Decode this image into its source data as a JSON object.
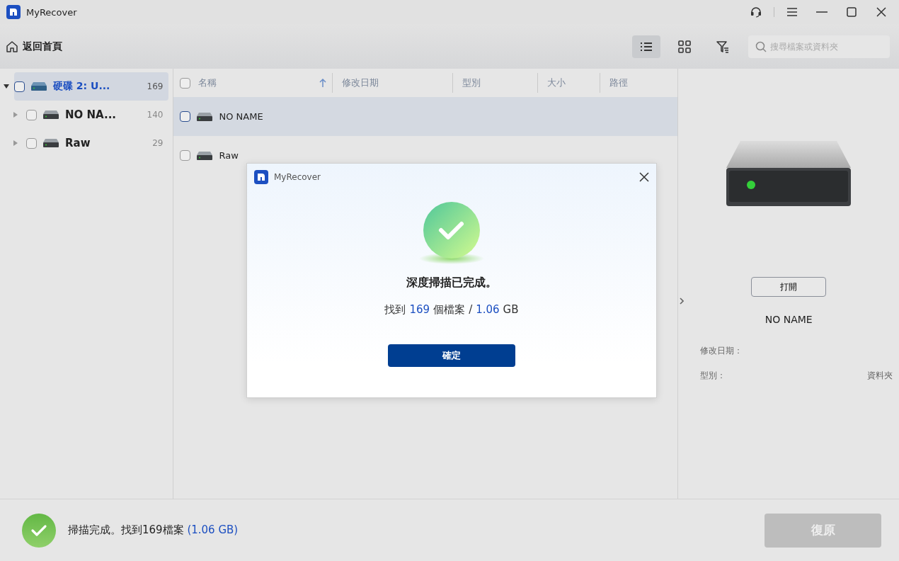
{
  "window": {
    "title": "MyRecover"
  },
  "title_bar_buttons": [
    {
      "kind": "support"
    },
    {
      "kind": "menu"
    },
    {
      "kind": "minimize"
    },
    {
      "kind": "maximize"
    },
    {
      "kind": "close"
    }
  ],
  "toolbar": {
    "back_label": "返回首頁",
    "views": [
      {
        "kind": "list",
        "selected": true
      },
      {
        "kind": "grid",
        "selected": false
      },
      {
        "kind": "filter",
        "selected": false
      }
    ],
    "search": {
      "placeholder": "搜尋檔案或資料夾"
    }
  },
  "tree": [
    {
      "label": "硬碟 2: U...",
      "count": "169",
      "selected": true,
      "expanded": true,
      "checked": false,
      "children": [
        {
          "label": "NO NA...",
          "count": "140",
          "selected": false,
          "expanded": false,
          "checked": false
        },
        {
          "label": "Raw",
          "count": "29",
          "selected": false,
          "expanded": false,
          "checked": false
        }
      ]
    }
  ],
  "table": {
    "all_checked": false,
    "columns": [
      {
        "label": "名稱",
        "sorted": true
      },
      {
        "label": "修改日期",
        "sorted": false
      },
      {
        "label": "型別",
        "sorted": false
      },
      {
        "label": "大小",
        "sorted": false
      },
      {
        "label": "路徑",
        "sorted": false
      }
    ],
    "rows": [
      {
        "name": "NO NAME",
        "selected": true,
        "checked": false
      },
      {
        "name": "Raw",
        "selected": false,
        "checked": false
      }
    ]
  },
  "details": {
    "open_button": "打開",
    "name": "NO NAME",
    "fields": [
      {
        "label": "修改日期："
      },
      {
        "label": "型別：",
        "value": "資料夾"
      }
    ]
  },
  "status_bar": {
    "message": "掃描完成。找到169檔案",
    "size": "(1.06 GB)",
    "recover_button": "復原",
    "recover_disabled": true
  },
  "dialog": {
    "title": "MyRecover",
    "heading": "深度掃描已完成。",
    "summary": [
      {
        "text": "找到",
        "highlight": false
      },
      {
        "text": "169",
        "highlight": true
      },
      {
        "text": "個檔案",
        "highlight": false
      },
      {
        "text": "/",
        "highlight": false
      },
      {
        "text": "1.06",
        "highlight": true
      },
      {
        "text": "GB",
        "highlight": false
      }
    ],
    "ok_button": "確定"
  }
}
